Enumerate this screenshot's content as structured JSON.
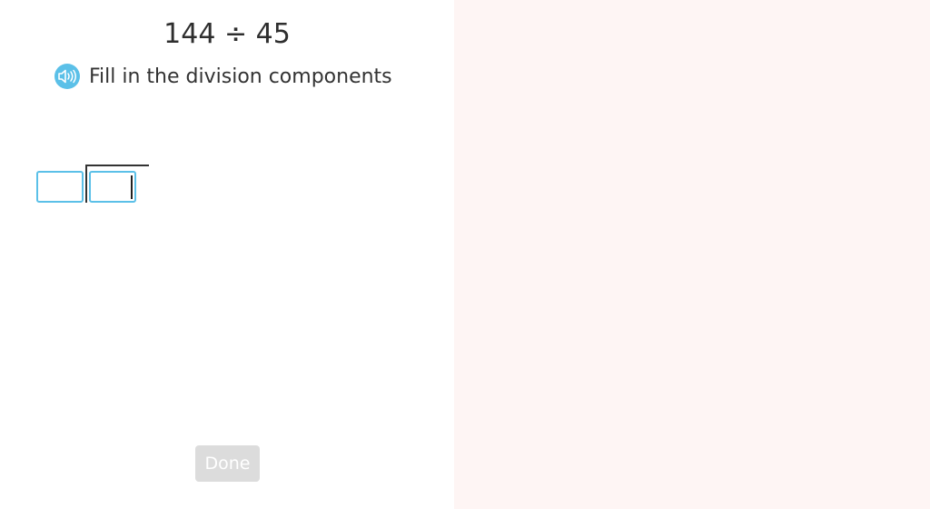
{
  "problem": {
    "expression": "144 ÷ 45"
  },
  "instruction": {
    "text": "Fill in the division components",
    "icon": "speaker-icon"
  },
  "division": {
    "divisor_value": "",
    "dividend_value": ""
  },
  "footer": {
    "done_label": "Done"
  },
  "colors": {
    "accent": "#5bc0e8",
    "right_panel_bg": "#fef5f4",
    "done_disabled_bg": "#dcdcdc"
  }
}
